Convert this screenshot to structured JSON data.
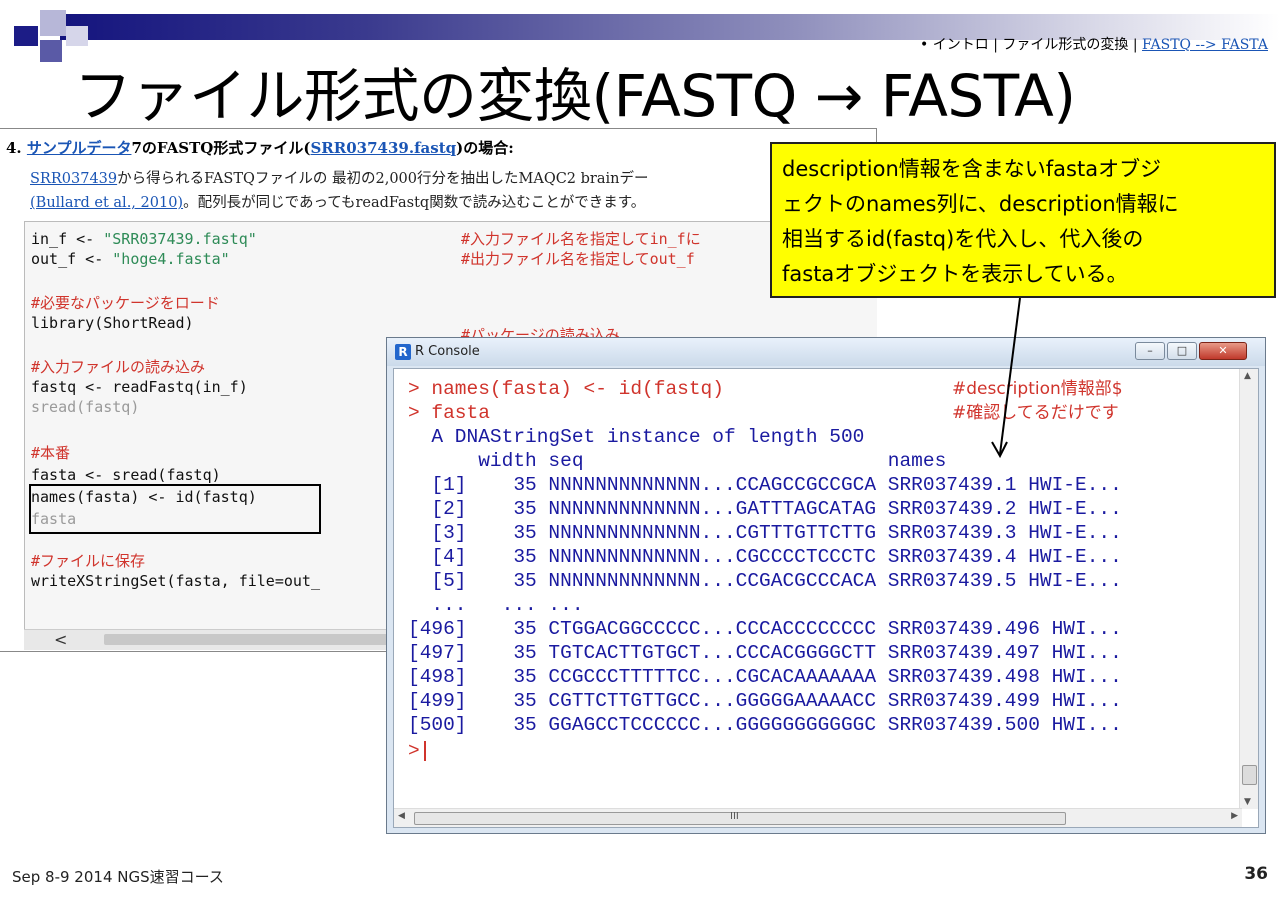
{
  "breadcrumb": {
    "prefix": "• イントロ | ファイル形式の変換 | ",
    "link": "FASTQ --> FASTA"
  },
  "slide_title": "ファイル形式の変換(FASTQ → FASTA)",
  "document": {
    "heading_num": "4. ",
    "heading_link1": "サンプルデータ",
    "heading_mid": "7のFASTQ形式ファイル(",
    "heading_link2": "SRR037439.fastq",
    "heading_end": ")の場合:",
    "para1_link": "SRR037439",
    "para1_text": "から得られるFASTQファイルの 最初の2,000行分を抽出したMAQC2 brainデー",
    "para2_link": "(Bullard et al., 2010)",
    "para2_text": "。配列長が同じであってもreadFastq関数で読み込むことができます。",
    "code": {
      "l1_code": "in_f <- ",
      "l1_str": "\"SRR037439.fastq\"",
      "l1_comment": "#入力ファイル名を指定してin_fに",
      "l2_code": "out_f <- ",
      "l2_str": "\"hoge4.fasta\"",
      "l2_comment": "#出力ファイル名を指定してout_f",
      "l3_comment": "#必要なパッケージをロード",
      "l4_code": "library(ShortRead)",
      "l4_comment": "#パッケージの読み込み",
      "l5_comment": "#入力ファイルの読み込み",
      "l6_code": "fastq <- readFastq(in_f)",
      "l7_code": "sread(fastq)",
      "l8_comment": "#本番",
      "l9_code": "fasta <- sread(fastq)",
      "l10_code": "names(fasta) <- id(fastq)",
      "l11_code": "fasta",
      "l12_comment": "#ファイルに保存",
      "l13_code": "writeXStringSet(fasta, file=out_"
    },
    "scroll_left_arrow": "<"
  },
  "callout": {
    "line1": "description情報を含まないfastaオブジ",
    "line2": "ェクトのnames列に、description情報に",
    "line3": "相当するid(fastq)を代入し、代入後の",
    "line4": "fastaオブジェクトを表示している。"
  },
  "rconsole": {
    "window_title": "R Console",
    "app_icon": "R",
    "lines": [
      {
        "text": "> names(fasta) <- id(fastq)",
        "comment": "#description情報部$",
        "color": "red"
      },
      {
        "text": "> fasta",
        "comment": "#確認してるだけです",
        "color": "red"
      },
      {
        "text": "  A DNAStringSet instance of length 500",
        "color": "blue"
      },
      {
        "text": "      width seq                          names",
        "color": "blue"
      },
      {
        "text": "  [1]    35 NNNNNNNNNNNNN...CCAGCCGCCGCA SRR037439.1 HWI-E...",
        "color": "blue"
      },
      {
        "text": "  [2]    35 NNNNNNNNNNNNN...GATTTAGCATAG SRR037439.2 HWI-E...",
        "color": "blue"
      },
      {
        "text": "  [3]    35 NNNNNNNNNNNNN...CGTTTGTTCTTG SRR037439.3 HWI-E...",
        "color": "blue"
      },
      {
        "text": "  [4]    35 NNNNNNNNNNNNN...CGCCCCTCCCTC SRR037439.4 HWI-E...",
        "color": "blue"
      },
      {
        "text": "  [5]    35 NNNNNNNNNNNNN...CCGACGCCCACA SRR037439.5 HWI-E...",
        "color": "blue"
      },
      {
        "text": "  ...   ... ...",
        "color": "blue"
      },
      {
        "text": "[496]    35 CTGGACGGCCCCC...CCCACCCCCCCC SRR037439.496 HWI...",
        "color": "blue"
      },
      {
        "text": "[497]    35 TGTCACTTGTGCT...CCCACGGGGCTT SRR037439.497 HWI...",
        "color": "blue"
      },
      {
        "text": "[498]    35 CCGCCCTTTTTCC...CGCACAAAAAAA SRR037439.498 HWI...",
        "color": "blue"
      },
      {
        "text": "[499]    35 CGTTCTTGTTGCC...GGGGGAAAAACC SRR037439.499 HWI...",
        "color": "blue"
      },
      {
        "text": "[500]    35 GGAGCCTCCCCCC...GGGGGGGGGGGC SRR037439.500 HWI...",
        "color": "blue"
      }
    ],
    "prompt": ">",
    "hscroll_mid": "III"
  },
  "footer": {
    "left": "Sep 8-9 2014 NGS速習コース",
    "page_number": "36"
  }
}
